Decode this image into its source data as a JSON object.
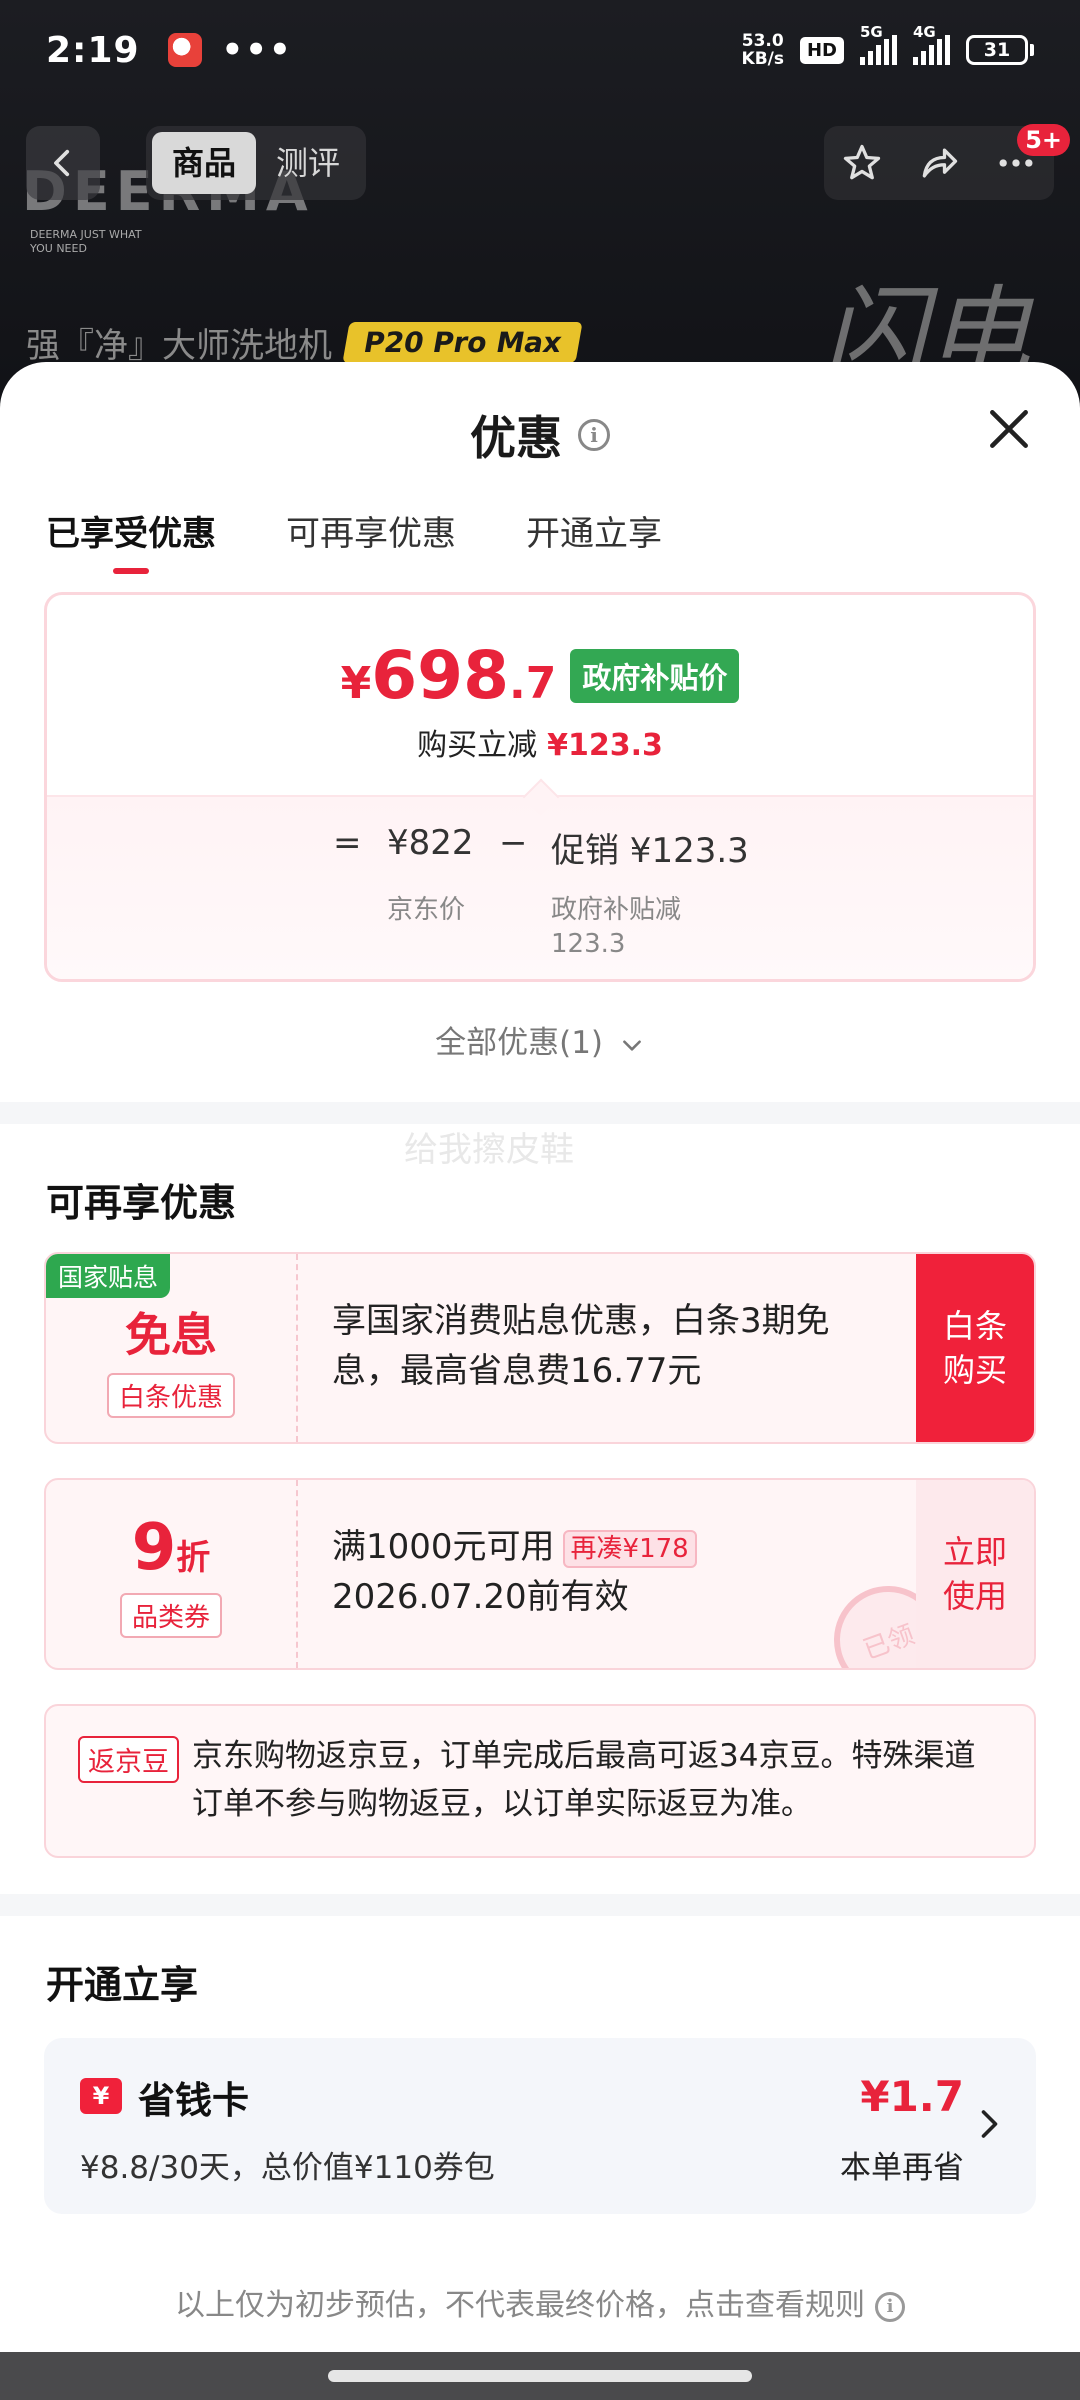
{
  "status_bar": {
    "time": "2:19",
    "dots": "•••",
    "net_speed_value": "53.0",
    "net_speed_unit": "KB/s",
    "hd_label": "HD",
    "sim1_label": "5G",
    "sim2_label": "4G",
    "battery": "31"
  },
  "product_nav": {
    "tabs": [
      "商品",
      "测评"
    ],
    "active_tab": "商品",
    "cart_badge": "5+",
    "brand_logo": "DEERMA",
    "brand_slogan_line1": "DEERMA JUST WHAT",
    "brand_slogan_line2": "YOU NEED",
    "product_name": "强『净』大师洗地机",
    "model_tag": "P20 Pro Max",
    "art_text": "闪电"
  },
  "sheet": {
    "title": "优惠",
    "tabs": [
      "已享受优惠",
      "可再享优惠",
      "开通立享"
    ],
    "active_tab": "已享受优惠"
  },
  "price_card": {
    "yen": "¥",
    "price_int": "698",
    "price_dec": ".7",
    "gov_tag": "政府补贴价",
    "instant_label": "购买立减",
    "instant_amount": "¥123.3",
    "eq": "=",
    "jd_price": "¥822",
    "minus": "−",
    "promo_label": "促销 ¥123.3",
    "jd_price_label": "京东价",
    "promo_sub_line1": "政府补贴减",
    "promo_sub_line2": "123.3"
  },
  "all_promos": "全部优惠(1)",
  "watermark": "给我擦皮鞋",
  "more_section": {
    "title": "可再享优惠",
    "coupons": [
      {
        "corner": "国家贴息",
        "main": "免息",
        "sub": "白条优惠",
        "text": "享国家消费贴息优惠，白条3期免息，最高省息费16.77元",
        "action_line1": "白条",
        "action_line2": "购买"
      },
      {
        "main_big": "9",
        "main_small": "折",
        "sub": "品类券",
        "text_line1": "满1000元可用",
        "add_tag": "再凑¥178",
        "text_line2": "2026.07.20前有效",
        "action_line1": "立即",
        "action_line2": "使用",
        "stamp": "已领"
      }
    ],
    "bean": {
      "tag": "返京豆",
      "text": "京东购物返京豆，订单完成后最高可返34京豆。特殊渠道订单不参与购物返豆，以订单实际返豆为准。"
    }
  },
  "open_section": {
    "title": "开通立享",
    "card": {
      "icon": "¥",
      "name": "省钱卡",
      "desc": "¥8.8/30天，总价值¥110券包",
      "save_amount": "¥1.7",
      "save_label": "本单再省"
    }
  },
  "footnote": "以上仅为初步预估，不代表最终价格，点击查看规则",
  "colors": {
    "accent_red": "#e8233b",
    "gov_green": "#33a853",
    "model_tag_yellow": "#e8c22a"
  }
}
